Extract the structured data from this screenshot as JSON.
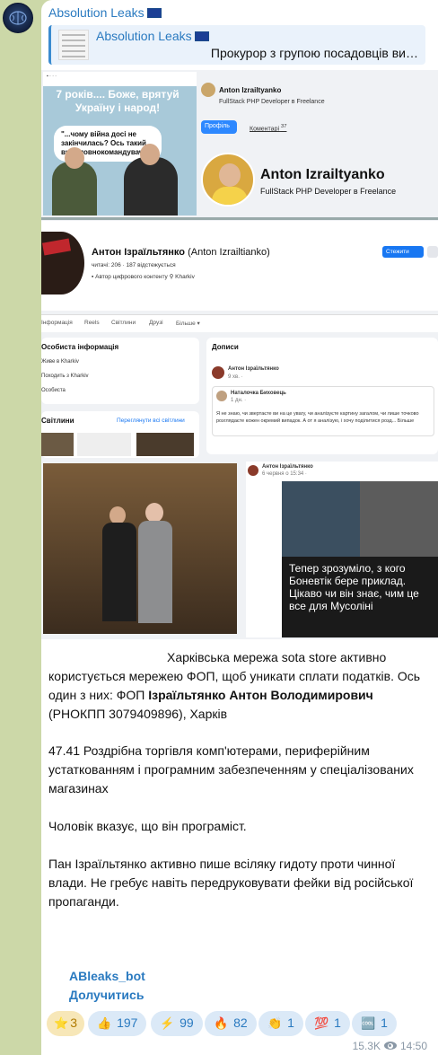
{
  "channel": {
    "title": "Absolution Leaks",
    "flag_icon": "eu-flag-icon"
  },
  "reply": {
    "name": "Absolution Leaks",
    "text": "Прокурор з групою посадовців ви…"
  },
  "screenshot": {
    "meme_caption": "7 років.... Боже, врятуй Україну і народ!",
    "meme_bubble": "\"...чому війна досі не закінчилась? Ось такий ви головнокомандувач...\"",
    "small_name": "Anton Izrailtyanko",
    "small_sub": "FullStack PHP Developer в Freelance",
    "profile_btn": "Профіль",
    "comments": "Коментарі",
    "comments_count": "37",
    "big_name": "Anton Izrailtyanko",
    "big_sub": "FullStack PHP Developer в Freelance",
    "fb_name": "Антон Ізраїльтянко",
    "fb_name_alt": "(Anton Izrailtianko)",
    "fb_stats": "читачі: 206 · 187 відстежується",
    "fb_tags": "▪ Автор цифрового контенту  ⚲ Kharkiv",
    "fb_edit": "Стежити",
    "tabs": [
      "Інформація",
      "Reels",
      "Світлини",
      "Друзі",
      "Більше ▾"
    ],
    "info_title": "Особиста інформація",
    "info_lines": [
      "Живе в Kharkiv",
      "Походить з Kharkiv",
      "Особиста"
    ],
    "posts_title": "Дописи",
    "post_author": "Антон Ізраїльтянко",
    "post_time": "9 хв. · ",
    "shared_author": "Наталочка Биховець",
    "shared_time": "1 дн. ·",
    "shared_text": "Я не знаю, чи звертаєте ви на це увагу, чи аналізуєте картину загалом, чи лише точково розглядаєте кожен окремий випадок. А от я аналізую, і хочу поділитися розд... Більше",
    "photos_title": "Світлини",
    "photos_link": "Переглянути всі світлини",
    "post2_author": "Антон Ізраїльтянко",
    "post2_time": "6 червня о 15:34 · ",
    "post2_text": "Тепер зрозуміло, з кого Боневтік бере приклад. Цікаво чи він знає, чим це все для Мусоліні"
  },
  "message": {
    "p1a": "Харківська мережа sota store активно користується мережею ФОП, щоб уникати сплати податків. Ось один з них: ФОП ",
    "p1b": "Ізраїльтянко Антон Володимирович",
    "p1c": " (РНОКПП 3079409896), Харків",
    "p2": "47.41 Роздрібна торгівля комп'ютерами, периферійним устаткованням і програмним забезпеченням у спеціалізованих магазинах",
    "p3": "Чоловік вказує, що він програміст.",
    "p4": "Пан Ізраїльтянко активно пише всіляку гидоту проти чинної влади. Не гребує навіть передруковувати фейки від російської пропаганди.",
    "bot": "ABleaks_bot",
    "join": "Долучитись"
  },
  "reactions": [
    {
      "emoji": "⭐",
      "count": "3"
    },
    {
      "emoji": "👍",
      "count": "197"
    },
    {
      "emoji": "⚡",
      "count": "99"
    },
    {
      "emoji": "🔥",
      "count": "82"
    },
    {
      "emoji": "👏",
      "count": "1"
    },
    {
      "emoji": "💯",
      "count": "1"
    },
    {
      "emoji": "🆒",
      "count": "1"
    }
  ],
  "meta": {
    "views": "15.3K",
    "time": "14:50"
  }
}
